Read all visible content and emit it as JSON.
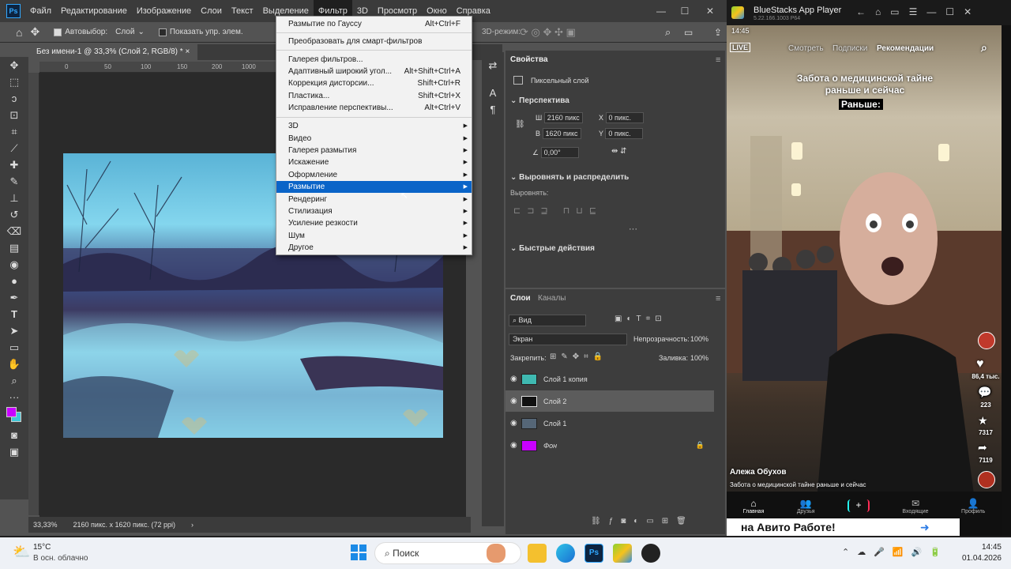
{
  "ps": {
    "logo": "Ps",
    "menu": [
      "Файл",
      "Редактирование",
      "Изображение",
      "Слои",
      "Текст",
      "Выделение",
      "Фильтр",
      "3D",
      "Просмотр",
      "Окно",
      "Справка"
    ],
    "options": {
      "autoselect": "Автовыбор:",
      "layer": "Слой",
      "show_controls": "Показать упр. элем.",
      "mode_3d": "3D-режим:"
    },
    "doc_tab": "Без имени-1 @ 33,3% (Слой 2, RGB/8) *",
    "ruler_marks": [
      "0",
      "50",
      "100",
      "150",
      "200",
      "250",
      "300",
      "350",
      "1000"
    ],
    "status": {
      "zoom": "33,33%",
      "info": "2160 пикс. x 1620 пикс. (72 ppi)"
    },
    "filter_menu": {
      "items": [
        {
          "label": "Размытие по Гауссу",
          "shortcut": "Alt+Ctrl+F"
        },
        {
          "label": "Преобразовать для смарт-фильтров"
        },
        {
          "label": "Галерея фильтров..."
        },
        {
          "label": "Адаптивный широкий угол...",
          "shortcut": "Alt+Shift+Ctrl+A"
        },
        {
          "label": "Коррекция дисторсии...",
          "shortcut": "Shift+Ctrl+R"
        },
        {
          "label": "Пластика...",
          "shortcut": "Shift+Ctrl+X"
        },
        {
          "label": "Исправление перспективы...",
          "shortcut": "Alt+Ctrl+V"
        },
        {
          "label": "3D"
        },
        {
          "label": "Видео"
        },
        {
          "label": "Галерея размытия"
        },
        {
          "label": "Искажение"
        },
        {
          "label": "Оформление"
        },
        {
          "label": "Размытие"
        },
        {
          "label": "Рендеринг"
        },
        {
          "label": "Стилизация"
        },
        {
          "label": "Усиление резкости"
        },
        {
          "label": "Шум"
        },
        {
          "label": "Другое"
        }
      ]
    },
    "properties": {
      "title": "Свойства",
      "layer_type": "Пиксельный слой",
      "perspective": "Перспектива",
      "w_label": "Ш",
      "w_value": "2160 пикс",
      "h_label": "В",
      "h_value": "1620 пикс",
      "x_label": "X",
      "x_value": "0 пикс.",
      "y_label": "Y",
      "y_value": "0 пикс.",
      "angle": "0,00°",
      "align_section": "Выровнять и распределить",
      "align_label": "Выровнять:",
      "quick_actions": "Быстрые действия"
    },
    "layers_panel": {
      "tab_layers": "Слои",
      "tab_channels": "Каналы",
      "filter": "Вид",
      "blend": "Экран",
      "opacity_label": "Непрозрачность:",
      "opacity": "100%",
      "lock_label": "Закрепить:",
      "fill_label": "Заливка:",
      "fill": "100%",
      "layers": [
        {
          "name": "Слой 1 копия",
          "color": "#3fb9b1"
        },
        {
          "name": "Слой 2",
          "color": "#111111"
        },
        {
          "name": "Слой 1",
          "color": "#556677"
        },
        {
          "name": "Фон",
          "color": "#c800ff"
        }
      ]
    }
  },
  "bluestacks": {
    "title": "BlueStacks App Player",
    "version": "5.22.166.1003 P64",
    "time": "14:45",
    "tabs": [
      "Смотреть",
      "Подписки",
      "Рекомендации"
    ],
    "caption1": "Забота о медицинской тайне",
    "caption2": "раньше и сейчас",
    "caption3": "Раньше:",
    "likes": "86,4 тыс.",
    "comments": "223",
    "favorites": "7317",
    "shares": "7119",
    "author": "Алежа Обухов",
    "description": "Забота о медицинской тайне раньше и сейчас",
    "nav": [
      "Главная",
      "Друзья",
      "+",
      "Входящие",
      "Профиль"
    ],
    "ad": "на Авито Работе!"
  },
  "taskbar": {
    "temp": "15°C",
    "weather": "В осн. облачно",
    "search": "Поиск",
    "time": "14:45",
    "date": "01.04.2026"
  }
}
